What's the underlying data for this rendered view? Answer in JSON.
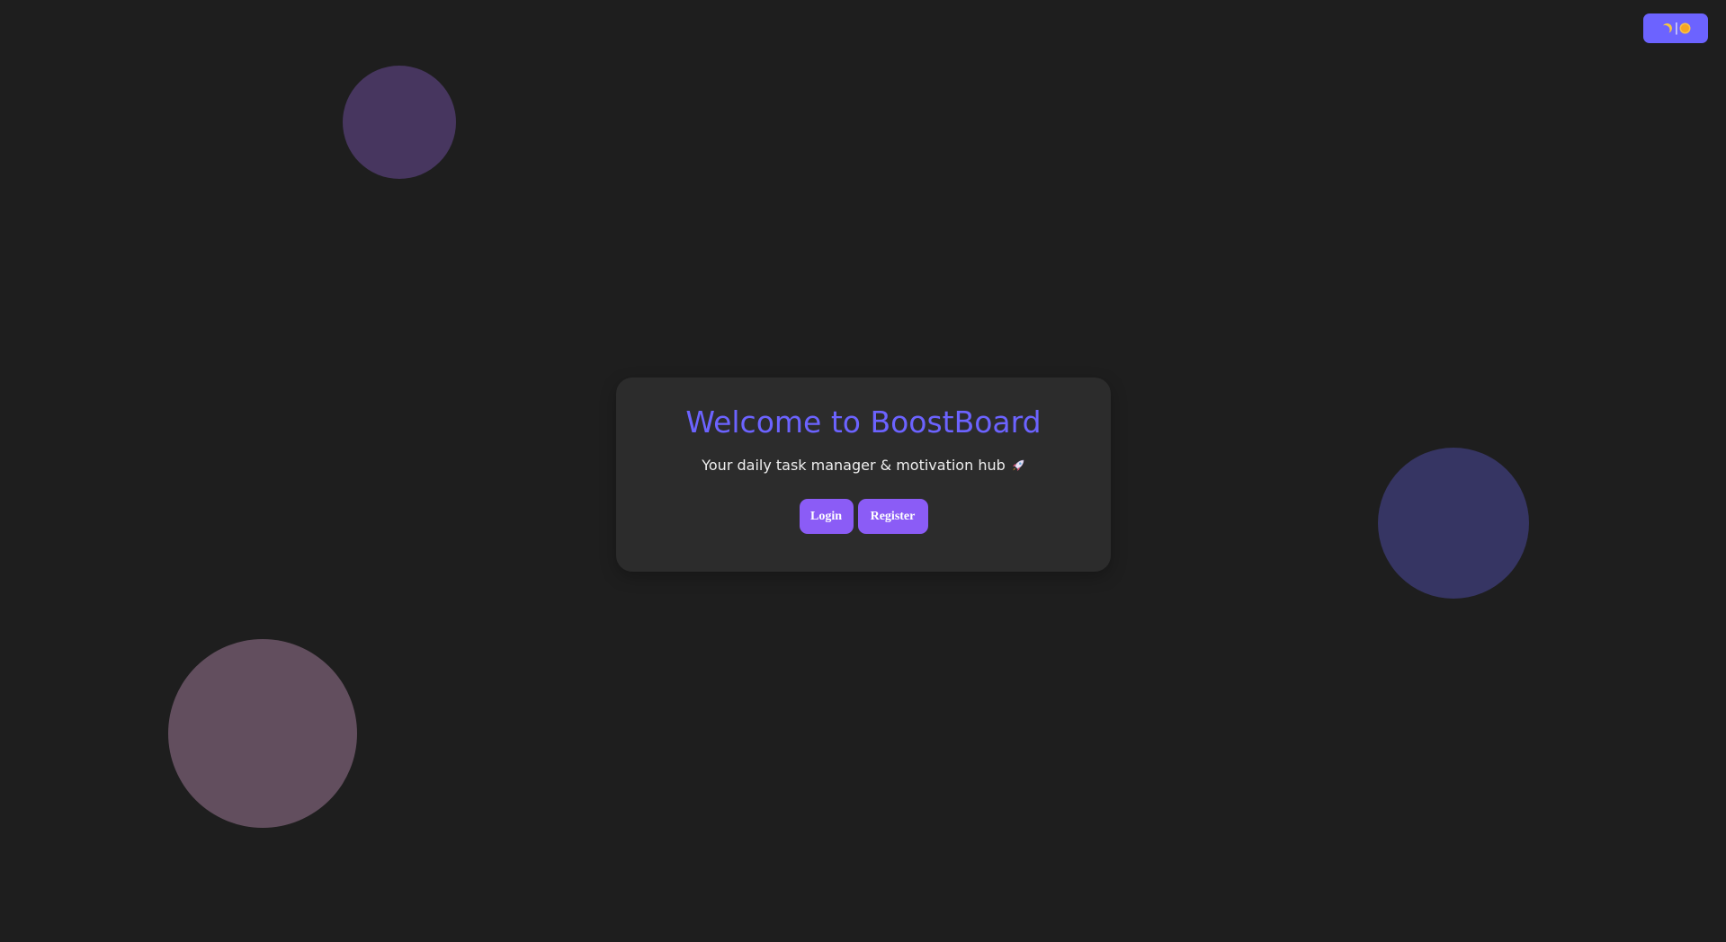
{
  "theme_toggle": {
    "moon_icon": "moon-icon",
    "separator": "|",
    "sun_icon": "sun-icon"
  },
  "hero": {
    "title": "Welcome to BoostBoard",
    "subtitle": "Your daily task manager & motivation hub",
    "subtitle_icon": "rocket-icon"
  },
  "actions": {
    "login_label": "Login",
    "register_label": "Register"
  },
  "colors": {
    "background": "#1e1e1e",
    "card": "#2c2c2c",
    "accent": "#6c63ff",
    "button": "#8b5cf6",
    "toggle": "#6c63ff",
    "bubble_1": "#47365f",
    "bubble_2": "#363563",
    "bubble_3": "#624e5e"
  }
}
